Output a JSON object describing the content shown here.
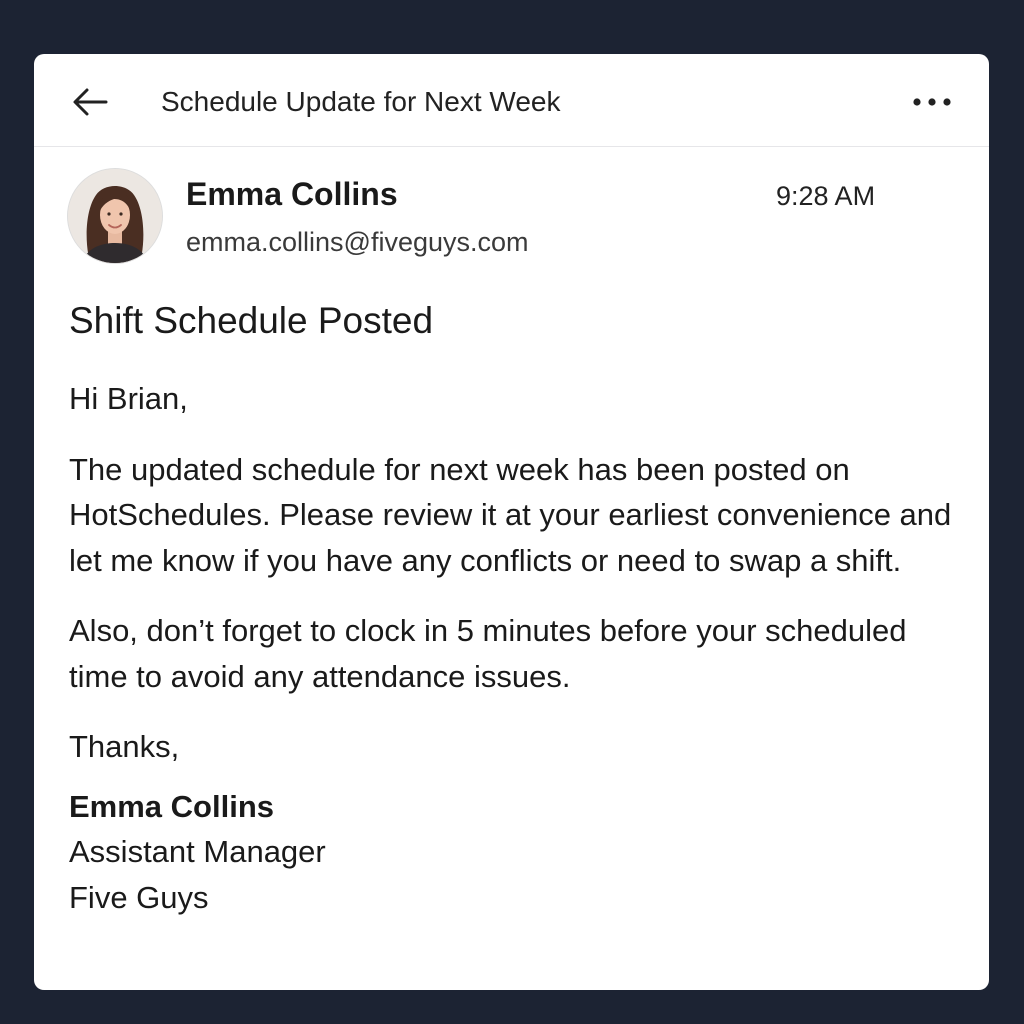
{
  "header": {
    "thread_title": "Schedule Update for Next Week",
    "back_icon": "arrow-left-icon",
    "more_icon": "more-horizontal-icon"
  },
  "message": {
    "sender_name": "Emma Collins",
    "sender_email": "emma.collins@fiveguys.com",
    "time": "9:28 AM",
    "subject": "Shift Schedule Posted",
    "greeting": "Hi Brian,",
    "paragraphs": [
      "The updated schedule for next week has been posted on HotSchedules. Please review it at your earliest convenience and let me know if you have any conflicts or need to swap a shift.",
      "Also, don’t forget to clock in 5 minutes before your scheduled time to avoid any attendance issues."
    ],
    "closing": "Thanks,",
    "signature": {
      "name": "Emma Collins",
      "title": "Assistant Manager",
      "company": "Five Guys"
    }
  },
  "colors": {
    "backdrop": "#1c2333",
    "card": "#ffffff",
    "text": "#1a1a1a"
  }
}
